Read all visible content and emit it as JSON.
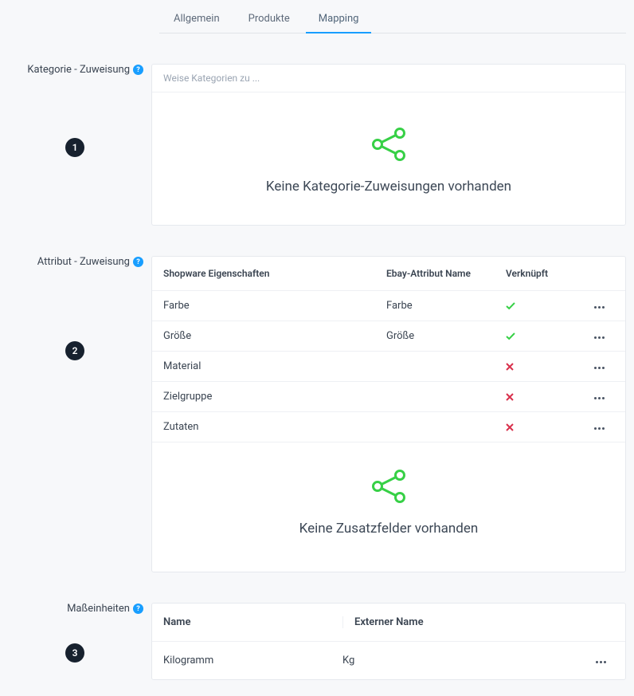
{
  "tabs": {
    "general": "Allgemein",
    "products": "Produkte",
    "mapping": "Mapping"
  },
  "sections": {
    "category": {
      "label": "Kategorie - Zuweisung",
      "step": "1",
      "placeholder": "Weise Kategorien zu ...",
      "empty_title": "Keine Kategorie-Zuweisungen vorhanden"
    },
    "attribute": {
      "label": "Attribut - Zuweisung",
      "step": "2",
      "headers": {
        "shopware": "Shopware Eigenschaften",
        "ebay": "Ebay-Attribut Name",
        "linked": "Verknüpft"
      },
      "rows": [
        {
          "shopware": "Farbe",
          "ebay": "Farbe",
          "linked": true
        },
        {
          "shopware": "Größe",
          "ebay": "Größe",
          "linked": true
        },
        {
          "shopware": "Material",
          "ebay": "",
          "linked": false
        },
        {
          "shopware": "Zielgruppe",
          "ebay": "",
          "linked": false
        },
        {
          "shopware": "Zutaten",
          "ebay": "",
          "linked": false
        }
      ],
      "empty_title": "Keine Zusatzfelder vorhanden"
    },
    "units": {
      "label": "Maßeinheiten",
      "step": "3",
      "headers": {
        "name": "Name",
        "external": "Externer Name"
      },
      "rows": [
        {
          "name": "Kilogramm",
          "external": "Kg"
        }
      ]
    }
  },
  "icons": {
    "help_glyph": "?"
  }
}
